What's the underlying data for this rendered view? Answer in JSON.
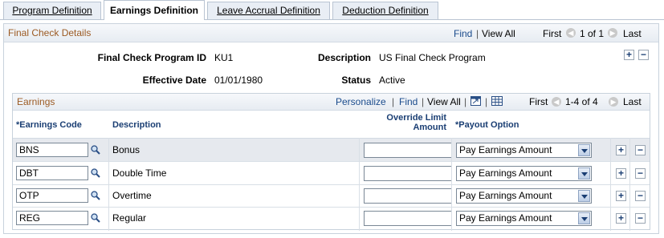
{
  "tabs": [
    {
      "label": "Program Definition"
    },
    {
      "label": "Earnings Definition"
    },
    {
      "label": "Leave Accrual Definition"
    },
    {
      "label": "Deduction Definition"
    }
  ],
  "final_check": {
    "title": "Final Check Details",
    "find": "Find",
    "view_all": "View All",
    "first": "First",
    "range": "1 of 1",
    "last": "Last",
    "program_id_label": "Final Check Program ID",
    "program_id": "KU1",
    "description_label": "Description",
    "description": "US Final Check Program",
    "effective_date_label": "Effective Date",
    "effective_date": "01/01/1980",
    "status_label": "Status",
    "status": "Active"
  },
  "earnings": {
    "title": "Earnings",
    "personalize": "Personalize",
    "find": "Find",
    "view_all": "View All",
    "first": "First",
    "range": "1-4 of 4",
    "last": "Last",
    "columns": {
      "code": "*Earnings Code",
      "description": "Description",
      "override_line1": "Override Limit",
      "override_line2": "Amount",
      "payout": "*Payout Option"
    },
    "rows": [
      {
        "code": "BNS",
        "description": "Bonus",
        "override": "",
        "payout": "Pay Earnings Amount"
      },
      {
        "code": "DBT",
        "description": "Double Time",
        "override": "",
        "payout": "Pay Earnings Amount"
      },
      {
        "code": "OTP",
        "description": "Overtime",
        "override": "",
        "payout": "Pay Earnings Amount"
      },
      {
        "code": "REG",
        "description": "Regular",
        "override": "",
        "payout": "Pay Earnings Amount"
      }
    ]
  },
  "icons": {
    "plus": "+",
    "minus": "−",
    "prev": "◀",
    "next": "▶",
    "sep": "|"
  }
}
